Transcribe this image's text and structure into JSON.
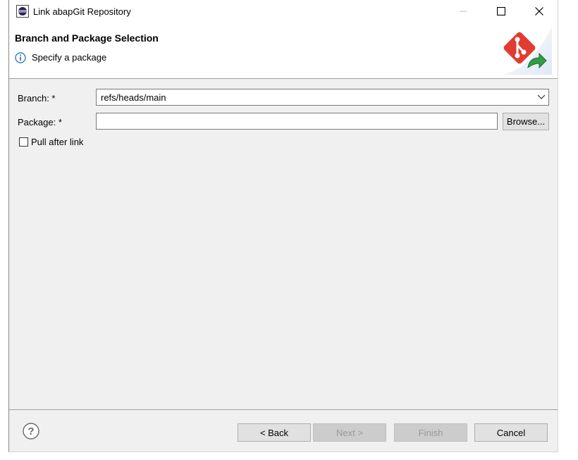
{
  "window": {
    "title": "Link abapGit Repository",
    "icons": {
      "app": "eclipse-icon",
      "minimize": "minimize-icon",
      "maximize": "maximize-icon",
      "close": "close-icon"
    }
  },
  "header": {
    "title": "Branch and Package Selection",
    "message": "Specify a package",
    "message_icon": "info-icon",
    "banner_icon": "abapgit-link-banner-icon"
  },
  "form": {
    "branch": {
      "label": "Branch: *",
      "value": "refs/heads/main"
    },
    "package": {
      "label": "Package: *",
      "value": "",
      "placeholder": ""
    },
    "browse_label": "Browse...",
    "pull_after_link": {
      "label": "Pull after link",
      "checked": false
    }
  },
  "footer": {
    "help_icon": "help-icon",
    "back_label": "< Back",
    "next_label": "Next >",
    "finish_label": "Finish",
    "cancel_label": "Cancel"
  },
  "colors": {
    "accent": "#0066cc",
    "banner_red": "#e03c31",
    "banner_green": "#2f9e44",
    "disabled_text": "#9a9a9a"
  }
}
